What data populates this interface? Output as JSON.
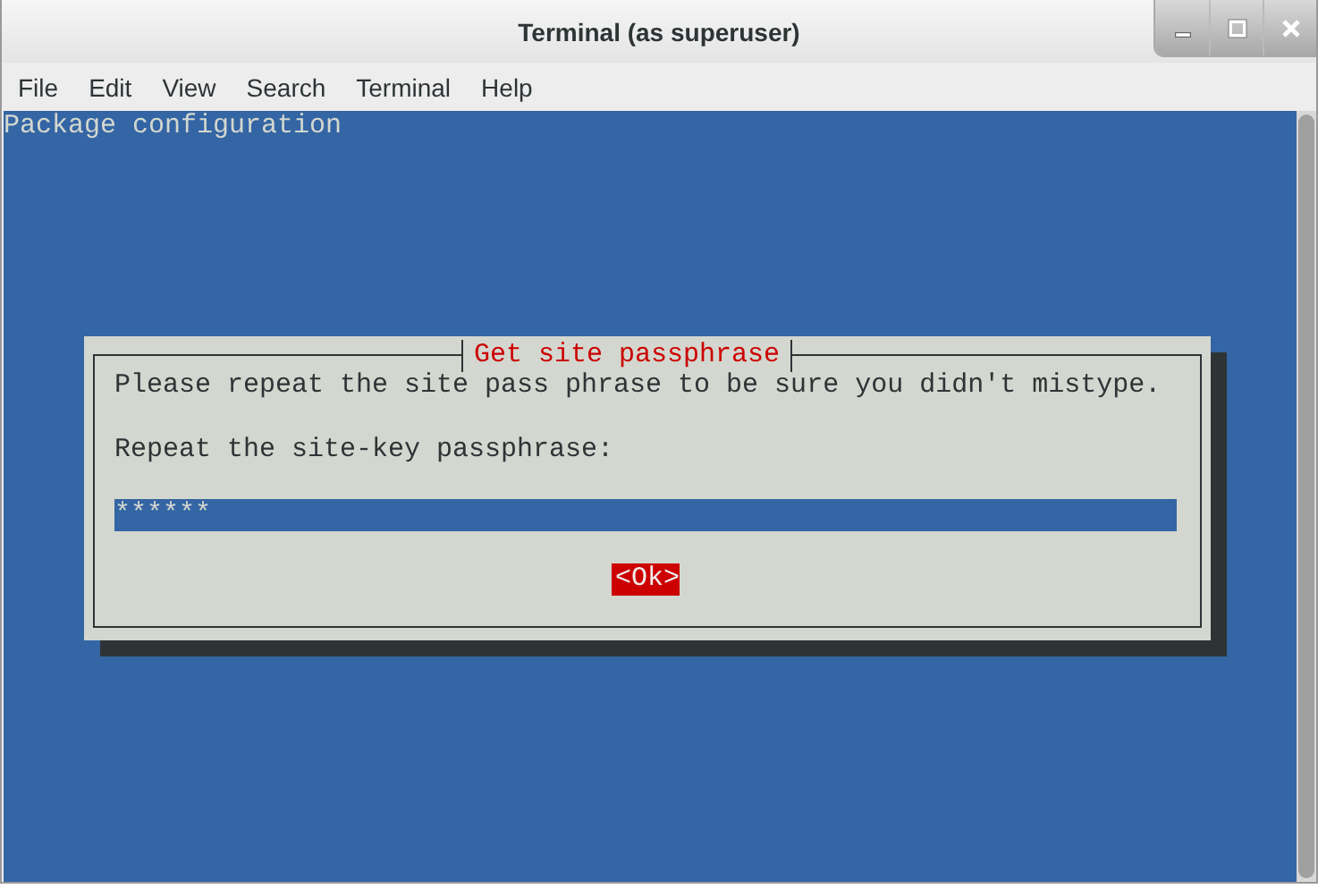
{
  "window": {
    "title": "Terminal (as superuser)"
  },
  "menu": [
    {
      "label": "File"
    },
    {
      "label": "Edit"
    },
    {
      "label": "View"
    },
    {
      "label": "Search"
    },
    {
      "label": "Terminal"
    },
    {
      "label": "Help"
    }
  ],
  "terminal": {
    "header": "Package configuration",
    "dialog": {
      "title": "Get site passphrase",
      "message": "Please repeat the site pass phrase to be sure you didn't mistype.",
      "prompt": "Repeat the site-key passphrase:",
      "field_value": "******",
      "buttons": [
        {
          "label": "<Ok>",
          "selected": true
        }
      ]
    }
  }
}
